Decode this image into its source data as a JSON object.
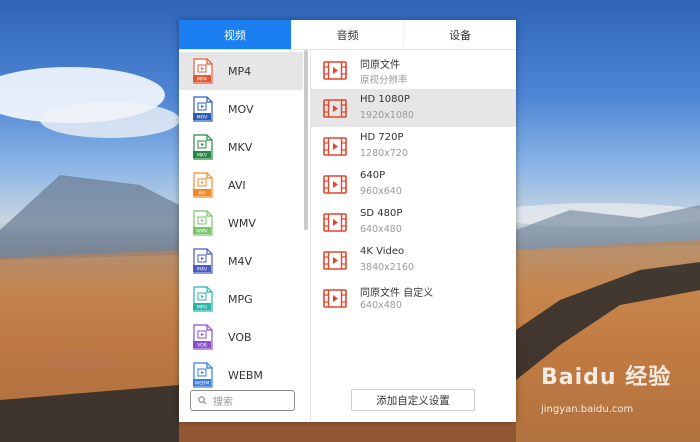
{
  "tabs": [
    {
      "label": "视频",
      "active": true
    },
    {
      "label": "音频",
      "active": false
    },
    {
      "label": "设备",
      "active": false
    }
  ],
  "formats": [
    {
      "label": "MP4",
      "tag": "MP4",
      "color": "#e05a3a",
      "selected": true
    },
    {
      "label": "MOV",
      "tag": "MOV",
      "color": "#2b5fb5",
      "selected": false
    },
    {
      "label": "MKV",
      "tag": "MKV",
      "color": "#268a45",
      "selected": false
    },
    {
      "label": "AVI",
      "tag": "AVI",
      "color": "#f08a28",
      "selected": false
    },
    {
      "label": "WMV",
      "tag": "WMV",
      "color": "#7ac46a",
      "selected": false
    },
    {
      "label": "M4V",
      "tag": "M4V",
      "color": "#4a5ac0",
      "selected": false
    },
    {
      "label": "MPG",
      "tag": "MPG",
      "color": "#2ab3a8",
      "selected": false
    },
    {
      "label": "VOB",
      "tag": "VOB",
      "color": "#8a4fd0",
      "selected": false
    },
    {
      "label": "WEBM",
      "tag": "WEBM",
      "color": "#3a7be0",
      "selected": false
    }
  ],
  "search": {
    "placeholder": "搜索"
  },
  "presets": [
    {
      "name": "同原文件",
      "res": "原视分辨率",
      "selected": false
    },
    {
      "name": "HD 1080P",
      "res": "1920x1080",
      "selected": true
    },
    {
      "name": "HD 720P",
      "res": "1280x720",
      "selected": false
    },
    {
      "name": "640P",
      "res": "960x640",
      "selected": false
    },
    {
      "name": "SD 480P",
      "res": "640x480",
      "selected": false
    },
    {
      "name": "4K Video",
      "res": "3840x2160",
      "selected": false
    },
    {
      "name": "同原文件 自定义",
      "res": "640x480",
      "selected": false
    }
  ],
  "add_button": "添加自定义设置",
  "watermark": {
    "brand": "Baidu 经验",
    "url": "jingyan.baidu.com"
  },
  "colors": {
    "accent": "#1b7ff1",
    "film_icon": "#e0462e"
  }
}
